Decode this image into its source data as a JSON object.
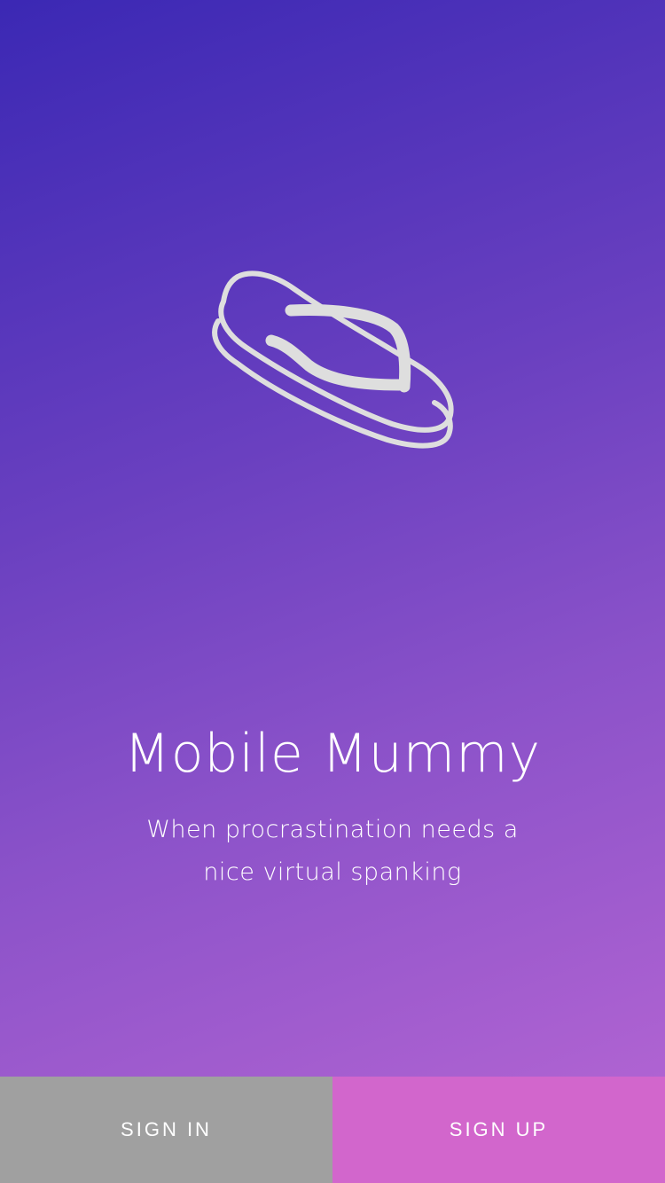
{
  "app": {
    "title": "Mobile Mummy",
    "tagline_line1": "When procrastination needs a",
    "tagline_line2": "nice virtual spanking"
  },
  "logo": {
    "icon": "flip-flop-icon"
  },
  "actions": {
    "sign_in_label": "SIGN IN",
    "sign_up_label": "SIGN UP"
  },
  "colors": {
    "gradient_start": "#3b28b4",
    "gradient_end": "#b867d4",
    "sign_in_bg": "#a0a0a0",
    "sign_up_bg": "#d266cc",
    "logo_stroke": "#dedede",
    "text": "#ffffff"
  }
}
